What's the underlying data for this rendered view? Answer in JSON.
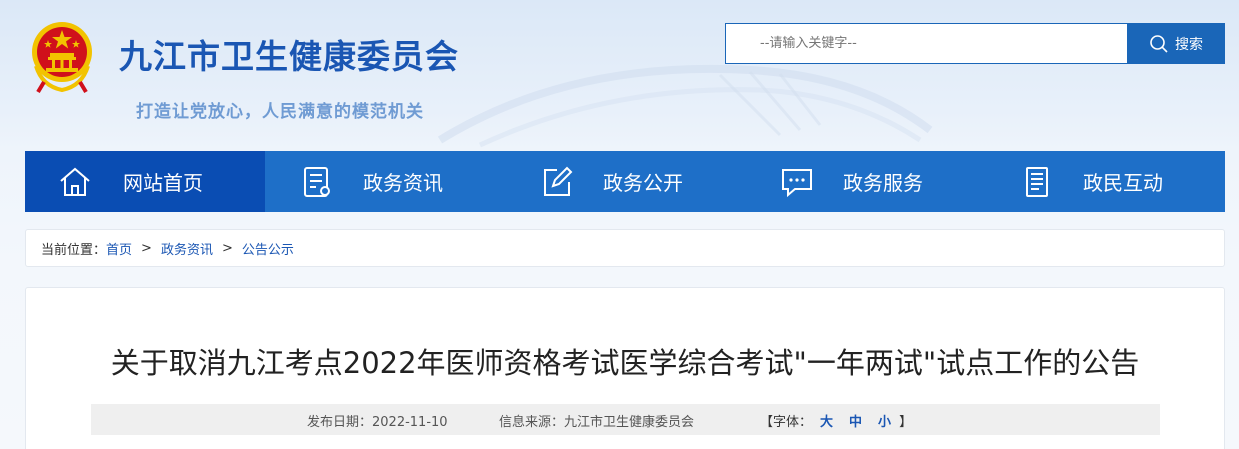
{
  "site": {
    "title": "九江市卫生健康委员会",
    "slogan": "打造让党放心，人民满意的模范机关"
  },
  "search": {
    "placeholder": "--请输入关键字--",
    "button_label": "搜索"
  },
  "nav": {
    "items": [
      {
        "label": "网站首页",
        "icon": "home-icon",
        "active": true
      },
      {
        "label": "政务资讯",
        "icon": "news-document-icon"
      },
      {
        "label": "政务公开",
        "icon": "edit-icon"
      },
      {
        "label": "政务服务",
        "icon": "chat-bubble-icon"
      },
      {
        "label": "政民互动",
        "icon": "document-list-icon"
      }
    ]
  },
  "breadcrumb": {
    "prefix": "当前位置：",
    "items": [
      "首页",
      "政务资讯",
      "公告公示"
    ],
    "separator": ">"
  },
  "article": {
    "title": "关于取消九江考点2022年医师资格考试医学综合考试\"一年两试\"试点工作的公告",
    "publish_date": "发布日期：2022-11-10",
    "source": "信息来源：九江市卫生健康委员会",
    "font_size_label": "【字体：",
    "font_large": "大",
    "font_medium": "中",
    "font_small": "小",
    "font_close": "】"
  },
  "colors": {
    "primary": "#1e6fc8",
    "nav_active": "#0a4db3",
    "title_blue": "#1a56b3",
    "emblem_red": "#d0101b",
    "emblem_gold": "#f2c300"
  }
}
